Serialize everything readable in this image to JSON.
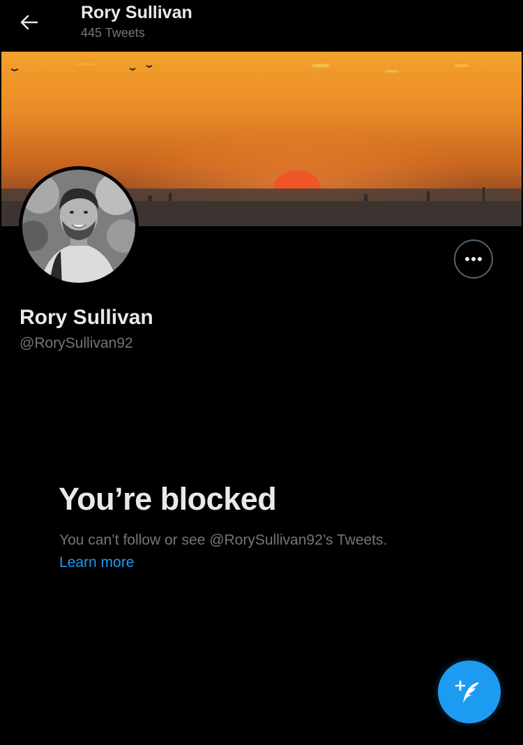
{
  "header": {
    "title": "Rory Sullivan",
    "tweet_count": "445 Tweets"
  },
  "profile": {
    "display_name": "Rory Sullivan",
    "handle": "@RorySullivan92"
  },
  "blocked": {
    "title": "You’re blocked",
    "description": "You can’t follow or see @RorySullivan92’s Tweets.",
    "learn_more_label": "Learn more"
  },
  "icons": {
    "back": "arrow-left-icon",
    "more": "more-horizontal-icon",
    "compose": "compose-tweet-icon"
  },
  "colors": {
    "background": "#000000",
    "accent": "#1d9bf0",
    "primary_text": "#e7e9ea",
    "secondary_text": "#71767b"
  }
}
